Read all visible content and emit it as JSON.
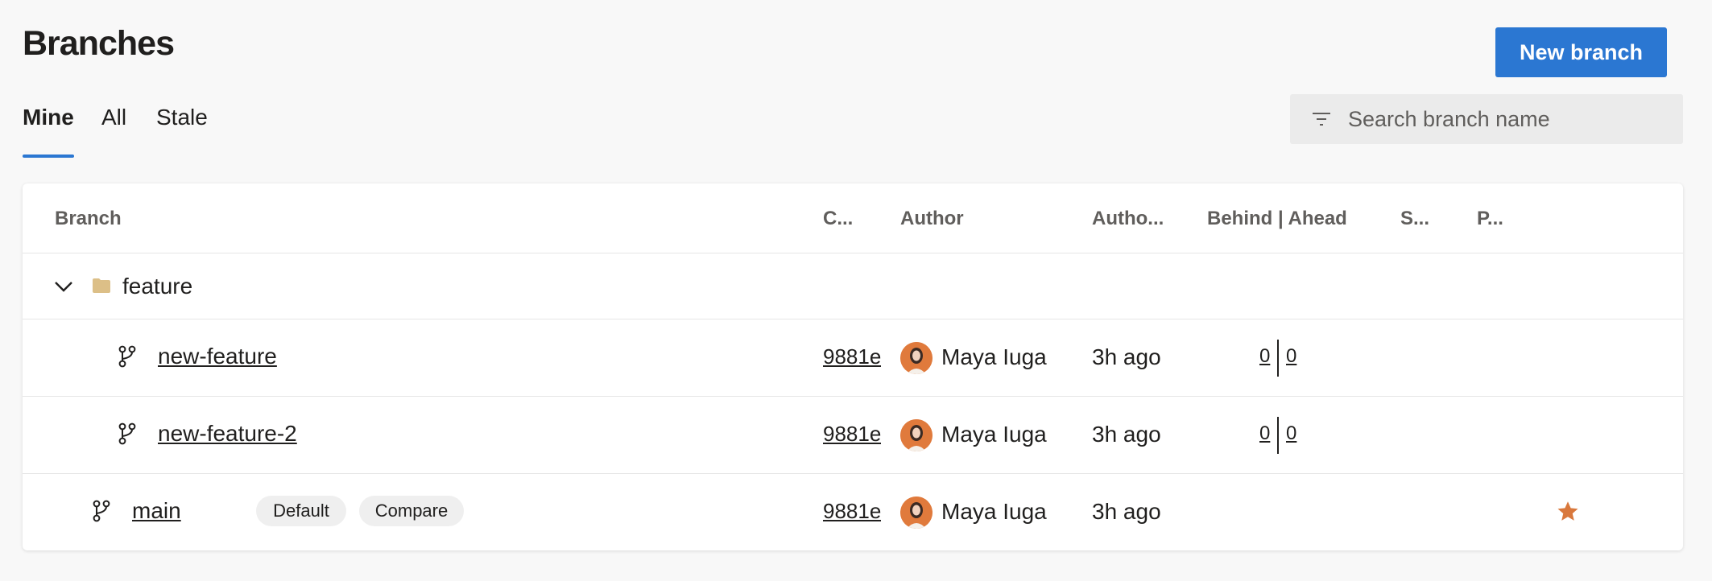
{
  "page": {
    "title": "Branches",
    "new_branch_label": "New branch"
  },
  "tabs": [
    {
      "label": "Mine",
      "active": true
    },
    {
      "label": "All",
      "active": false
    },
    {
      "label": "Stale",
      "active": false
    }
  ],
  "search": {
    "placeholder": "Search branch name",
    "value": "",
    "icon": "filter-icon"
  },
  "table": {
    "columns": {
      "branch": "Branch",
      "commit": "C...",
      "author": "Author",
      "authored": "Autho...",
      "behind_ahead": "Behind | Ahead",
      "status": "S...",
      "pull_request": "P..."
    },
    "folder": {
      "name": "feature",
      "expanded": true,
      "icon": "folder-icon"
    },
    "rows": [
      {
        "name": "new-feature",
        "commit": "9881e",
        "author": "Maya Iuga",
        "authored": "3h ago",
        "behind": "0",
        "ahead": "0"
      },
      {
        "name": "new-feature-2",
        "commit": "9881e",
        "author": "Maya Iuga",
        "authored": "3h ago",
        "behind": "0",
        "ahead": "0"
      },
      {
        "name": "main",
        "commit": "9881e",
        "author": "Maya Iuga",
        "authored": "3h ago",
        "default_label": "Default",
        "compare_label": "Compare",
        "favorite": true
      }
    ]
  },
  "colors": {
    "accent": "#2b77d2",
    "folder": "#dcbf87",
    "star": "#d9783c",
    "avatar": "#e07a3c"
  }
}
